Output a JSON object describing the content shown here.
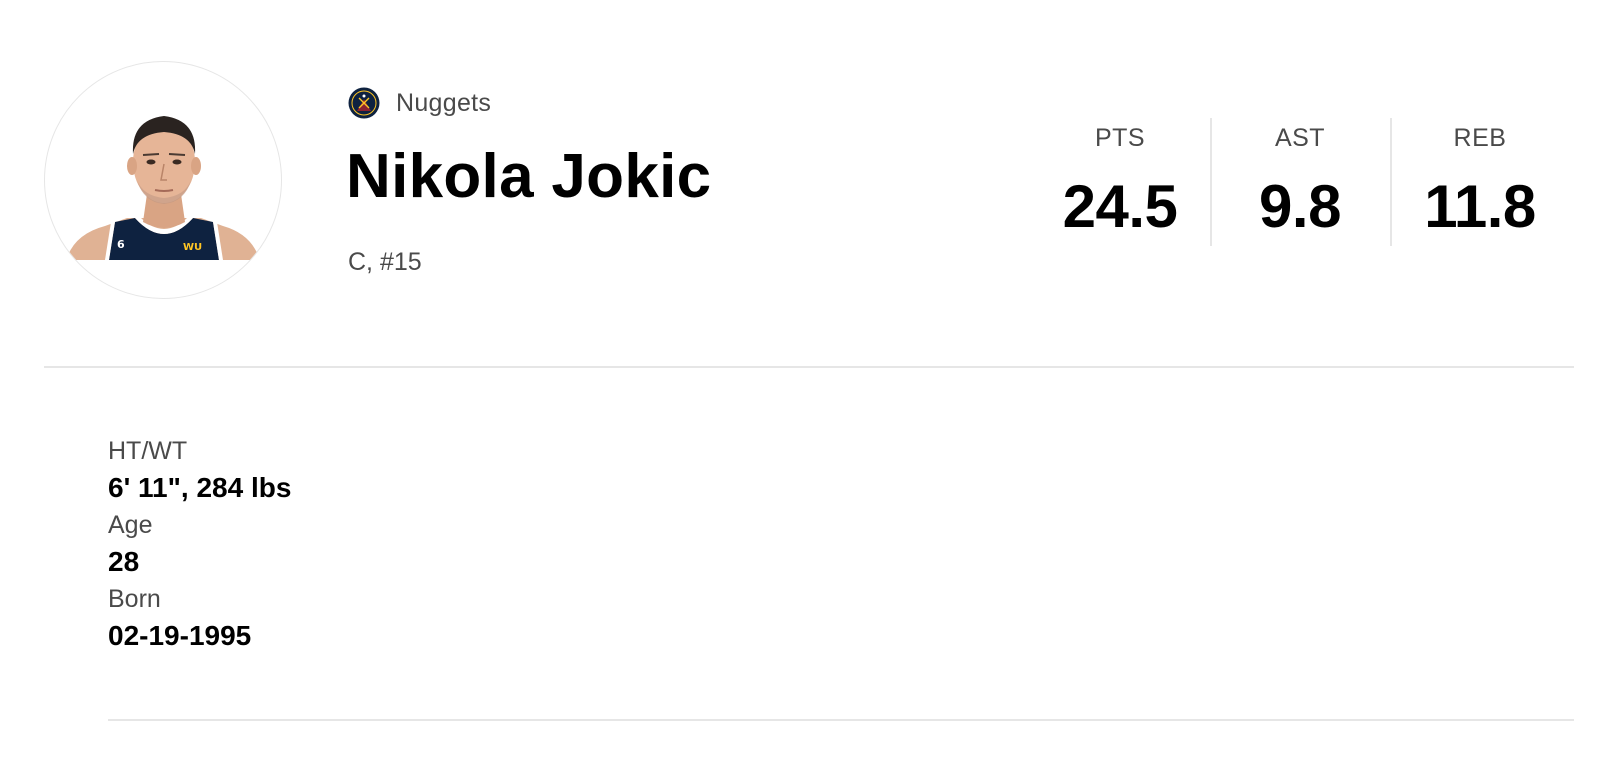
{
  "player": {
    "team_name": "Nuggets",
    "name": "Nikola Jokic",
    "position_number": "C, #15",
    "headshot_jersey_number": "6",
    "headshot_sponsor": "WU"
  },
  "stats": [
    {
      "label": "PTS",
      "value": "24.5"
    },
    {
      "label": "AST",
      "value": "9.8"
    },
    {
      "label": "REB",
      "value": "11.8"
    }
  ],
  "bio": [
    {
      "label": "HT/WT",
      "value": "6' 11\", 284 lbs"
    },
    {
      "label": "Age",
      "value": "28"
    },
    {
      "label": "Born",
      "value": "02-19-1995"
    }
  ],
  "colors": {
    "team_navy": "#0e2240",
    "team_gold": "#fec524",
    "team_red": "#8b2131",
    "divider": "#e6e6e6",
    "label_gray": "#4a4a4a"
  },
  "icons": {
    "team_logo": "nuggets-logo-icon",
    "avatar": "player-headshot"
  }
}
